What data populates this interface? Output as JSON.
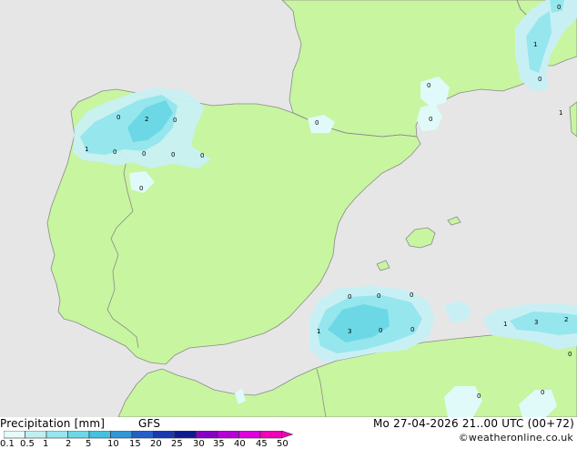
{
  "footer": {
    "legend_title": "Precipitation [mm]",
    "model": "GFS",
    "valid_time": "Mo 27-04-2026 21..00 UTC (00+72)",
    "credit": "©weatheronline.co.uk"
  },
  "legend": {
    "ticks": [
      "0.1",
      "0.5",
      "1",
      "2",
      "5",
      "10",
      "15",
      "20",
      "25",
      "30",
      "35",
      "40",
      "45",
      "50"
    ],
    "colors": [
      "#e6fafa",
      "#bff0f0",
      "#96e6ee",
      "#6cd8e6",
      "#44c2e0",
      "#2e98d8",
      "#2460c8",
      "#1a38b0",
      "#101a90",
      "#8a00c8",
      "#b800d8",
      "#de00de",
      "#f000b8"
    ]
  },
  "map": {
    "land_color": "#c8f5a0",
    "sea_color": "#e6e6e6",
    "border_color": "#8a8a8a",
    "precip_labels": [
      "0",
      "2",
      "0",
      "1",
      "0",
      "0",
      "0",
      "0",
      "0",
      "0",
      "0",
      "1",
      "0",
      "0",
      "0",
      "0",
      "0",
      "0",
      "1",
      "3",
      "0",
      "0",
      "1",
      "3",
      "2",
      "0",
      "0",
      "0",
      "1"
    ]
  }
}
